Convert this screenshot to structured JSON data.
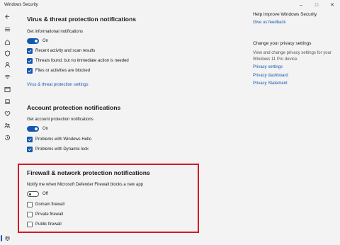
{
  "window": {
    "title": "Windows Security",
    "controls": {
      "minimize": "–",
      "maximize": "□",
      "close": "✕"
    }
  },
  "nav": {
    "icons": [
      "back-icon",
      "menu-icon",
      "home-icon",
      "shield-icon",
      "person-icon",
      "wifi-icon",
      "app-browser-icon",
      "laptop-icon",
      "heart-icon",
      "family-icon",
      "history-icon",
      "gear-icon"
    ]
  },
  "virus": {
    "heading": "Virus & threat protection notifications",
    "sub": "Get informational notifications",
    "toggle_label": "On",
    "checks": [
      "Recent activity and scan results",
      "Threats found, but no immediate action is needed",
      "Files or activities are blocked"
    ],
    "link": "Virus & threat protection settings"
  },
  "account": {
    "heading": "Account protection notifications",
    "sub": "Get account protection notifications",
    "toggle_label": "On",
    "checks": [
      "Problems with Windows Hello",
      "Problems with Dynamic lock"
    ]
  },
  "firewall": {
    "heading": "Firewall & network protection notifications",
    "sub": "Notify me when Microsoft Defender Firewall blocks a new app",
    "toggle_label": "Off",
    "checks": [
      "Domain firewall",
      "Private firewall",
      "Public firewall"
    ]
  },
  "sidebar_right": {
    "improve_heading": "Help improve Windows Security",
    "feedback_link": "Give us feedback",
    "privacy_heading": "Change your privacy settings",
    "privacy_desc": "View and change privacy settings for your Windows 11 Pro device.",
    "links": [
      "Privacy settings",
      "Privacy dashboard",
      "Privacy Statement"
    ]
  },
  "colors": {
    "accent": "#1558b0",
    "highlight": "#d11a2a",
    "background": "#f3f3f3"
  }
}
